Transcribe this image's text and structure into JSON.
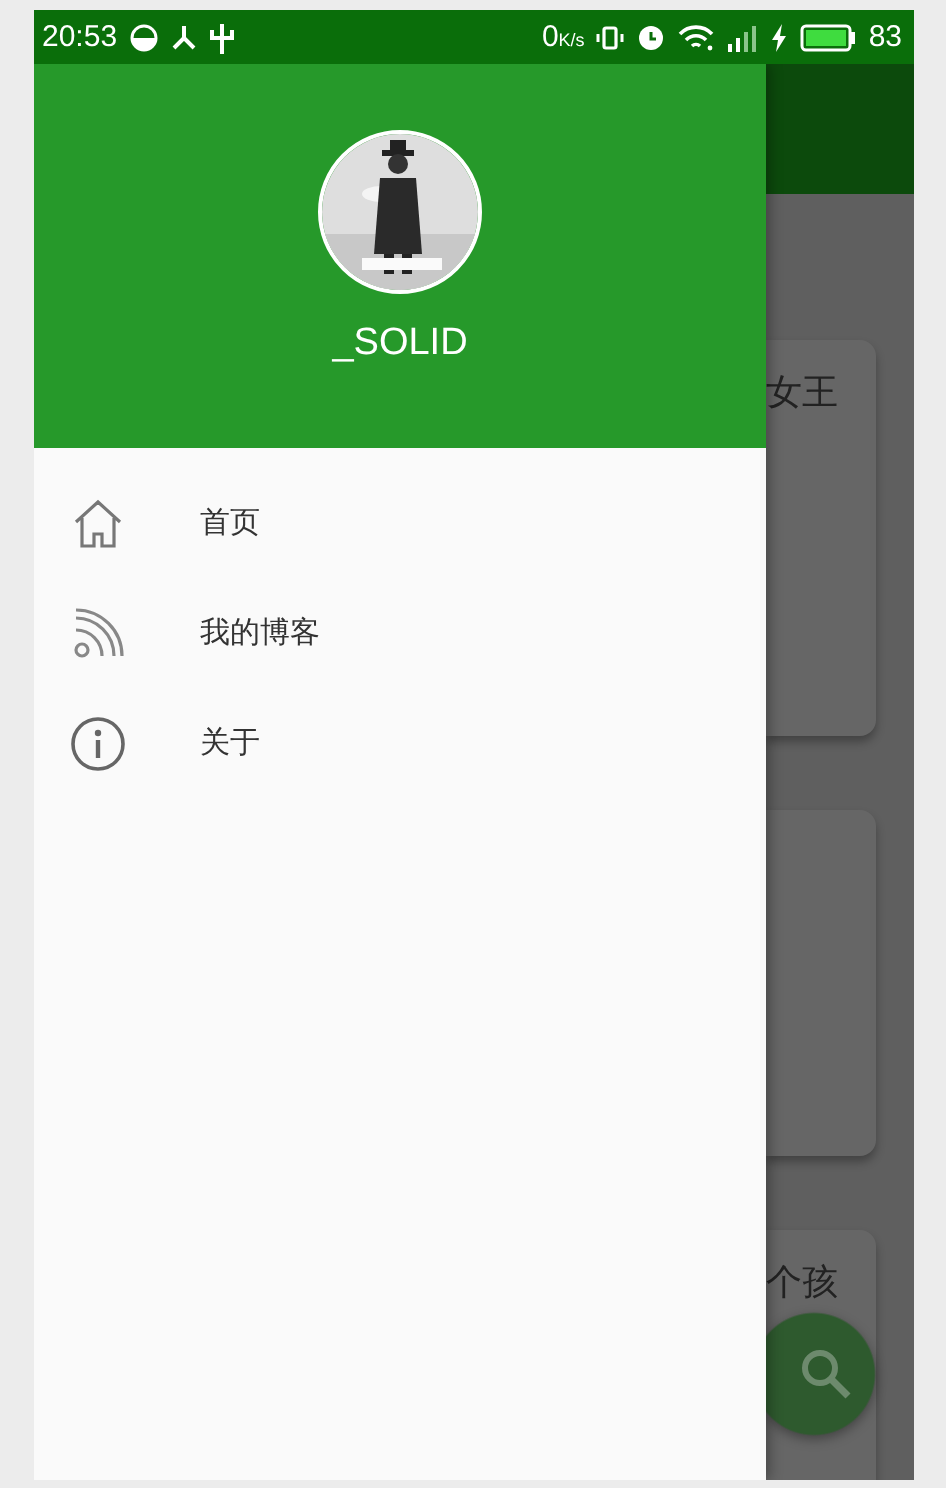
{
  "status_bar": {
    "time": "20:53",
    "net_speed": "0",
    "net_unit": "K/s",
    "battery": "83"
  },
  "drawer": {
    "user_name": "_SOLID",
    "menu": [
      {
        "label": "首页"
      },
      {
        "label": "我的博客"
      },
      {
        "label": "关于"
      }
    ]
  },
  "content": {
    "cards": [
      {
        "kind": "titled",
        "text": "女王"
      },
      {
        "kind": "plain"
      },
      {
        "kind": "titled",
        "text": "个孩"
      }
    ]
  }
}
